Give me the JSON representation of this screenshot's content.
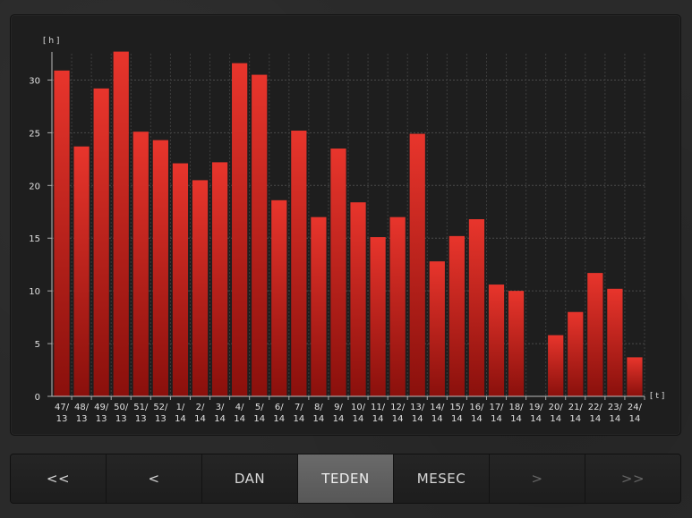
{
  "chart_data": {
    "type": "bar",
    "ylabel": "[ h ]",
    "xlabel": "[ t ]",
    "ylim": [
      0,
      32.5
    ],
    "yticks": [
      0,
      5,
      10,
      15,
      20,
      25,
      30
    ],
    "grid": true,
    "bar_color": "#d42a22",
    "categories": [
      [
        "47/",
        "13"
      ],
      [
        "48/",
        "13"
      ],
      [
        "49/",
        "13"
      ],
      [
        "50/",
        "13"
      ],
      [
        "51/",
        "13"
      ],
      [
        "52/",
        "13"
      ],
      [
        "1/",
        "14"
      ],
      [
        "2/",
        "14"
      ],
      [
        "3/",
        "14"
      ],
      [
        "4/",
        "14"
      ],
      [
        "5/",
        "14"
      ],
      [
        "6/",
        "14"
      ],
      [
        "7/",
        "14"
      ],
      [
        "8/",
        "14"
      ],
      [
        "9/",
        "14"
      ],
      [
        "10/",
        "14"
      ],
      [
        "11/",
        "14"
      ],
      [
        "12/",
        "14"
      ],
      [
        "13/",
        "14"
      ],
      [
        "14/",
        "14"
      ],
      [
        "15/",
        "14"
      ],
      [
        "16/",
        "14"
      ],
      [
        "17/",
        "14"
      ],
      [
        "18/",
        "14"
      ],
      [
        "19/",
        "14"
      ],
      [
        "20/",
        "14"
      ],
      [
        "21/",
        "14"
      ],
      [
        "22/",
        "14"
      ],
      [
        "23/",
        "14"
      ],
      [
        "24/",
        "14"
      ]
    ],
    "values": [
      30.9,
      23.7,
      29.2,
      32.7,
      25.1,
      24.3,
      22.1,
      20.5,
      22.2,
      31.6,
      30.5,
      18.6,
      25.2,
      17.0,
      23.5,
      18.4,
      15.1,
      17.0,
      24.9,
      12.8,
      15.2,
      16.8,
      10.6,
      10.0,
      0,
      5.8,
      8.0,
      11.7,
      10.2,
      3.7
    ]
  },
  "nav": {
    "first": "<<",
    "prev": "<",
    "day": "DAN",
    "week": "TEDEN",
    "month": "MESEC",
    "next": ">",
    "last": ">>"
  }
}
